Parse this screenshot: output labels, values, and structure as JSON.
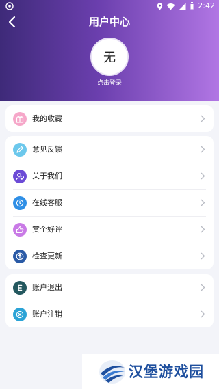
{
  "status_bar": {
    "time": "2:42"
  },
  "header": {
    "title": "用户中心",
    "avatar_text": "无",
    "login_label": "点击登录"
  },
  "groups": [
    [
      {
        "label": "我的收藏",
        "icon": "gift-icon",
        "color": "#f6a7c9"
      }
    ],
    [
      {
        "label": "意见反馈",
        "icon": "pen-icon",
        "color": "#6cc8ec"
      },
      {
        "label": "关于我们",
        "icon": "users-icon",
        "color": "#6c4bd6"
      },
      {
        "label": "在线客服",
        "icon": "clock-icon",
        "color": "#2f8fe6"
      },
      {
        "label": "赏个好评",
        "icon": "thumbs-up-icon",
        "color": "#c97ae6"
      },
      {
        "label": "检查更新",
        "icon": "upload-icon",
        "color": "#2a5aa6"
      }
    ],
    [
      {
        "label": "账户退出",
        "icon": "exit-icon",
        "color": "#24585f"
      },
      {
        "label": "账户注销",
        "icon": "cancel-icon",
        "color": "#2ba3d6"
      }
    ]
  ],
  "watermark": {
    "text": "汉堡游戏园"
  }
}
